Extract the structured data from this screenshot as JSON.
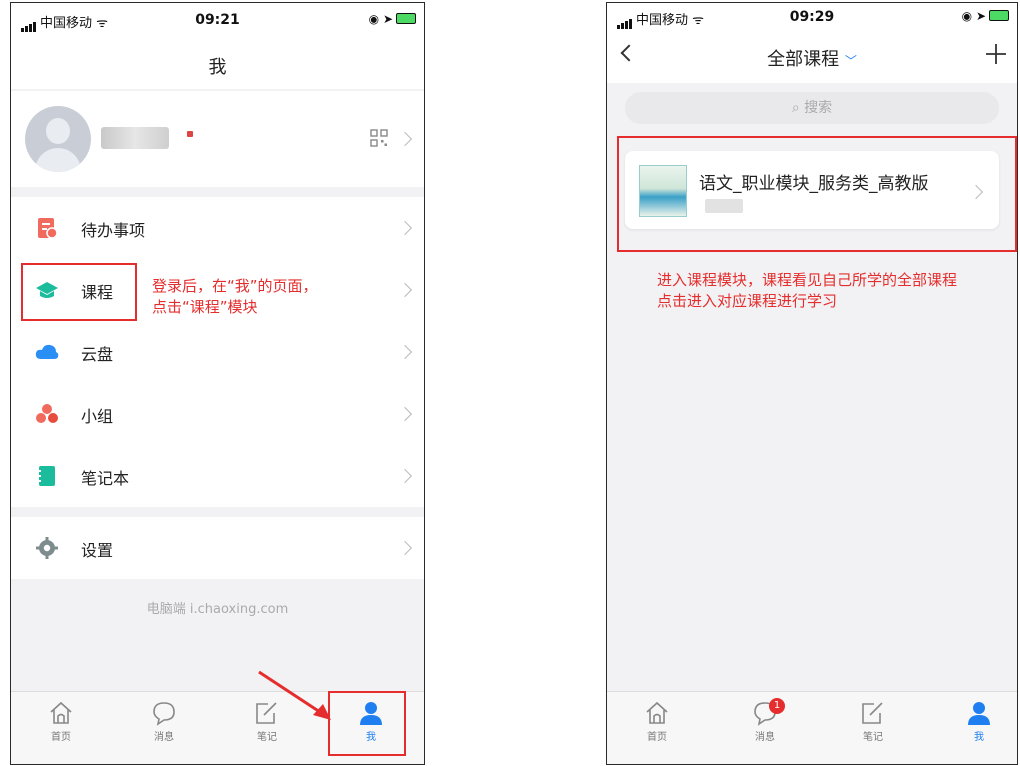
{
  "left": {
    "status": {
      "carrier": "中国移动",
      "time": "09:21"
    },
    "nav": {
      "title": "我"
    },
    "menu": [
      {
        "label": "待办事项"
      },
      {
        "label": "课程"
      },
      {
        "label": "云盘"
      },
      {
        "label": "小组"
      },
      {
        "label": "笔记本"
      },
      {
        "label": "设置"
      }
    ],
    "footer": "电脑端 i.chaoxing.com",
    "annotation": [
      "登录后，在“我”的页面，",
      "点击“课程”模块"
    ],
    "tabs": [
      {
        "label": "首页",
        "icon": "home-icon"
      },
      {
        "label": "消息",
        "icon": "message-icon"
      },
      {
        "label": "笔记",
        "icon": "note-icon"
      },
      {
        "label": "我",
        "icon": "person-icon"
      }
    ]
  },
  "right": {
    "status": {
      "carrier": "中国移动",
      "time": "09:29"
    },
    "nav": {
      "title": "全部课程"
    },
    "search": {
      "placeholder": "搜索"
    },
    "course": {
      "title": "语文_职业模块_服务类_高教版"
    },
    "annotation": [
      "进入课程模块，课程看见自己所学的全部课程",
      "点击进入对应课程进行学习"
    ],
    "badge": "1",
    "tabs": [
      {
        "label": "首页",
        "icon": "home-icon"
      },
      {
        "label": "消息",
        "icon": "message-icon"
      },
      {
        "label": "笔记",
        "icon": "note-icon"
      },
      {
        "label": "我",
        "icon": "person-icon"
      }
    ]
  },
  "colors": {
    "accent": "#1f7ff0",
    "annotation": "#e52d2d",
    "background": "#f2f2f4"
  }
}
